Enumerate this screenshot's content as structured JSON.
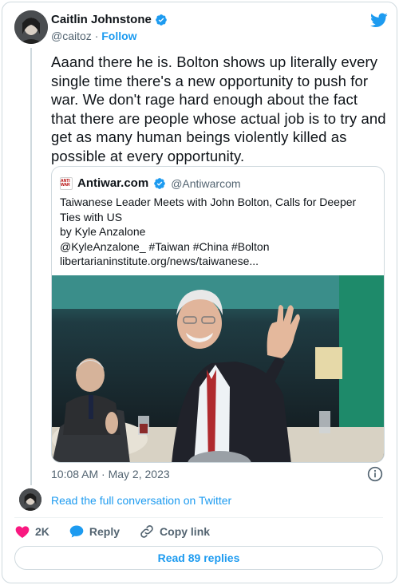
{
  "author": {
    "name": "Caitlin Johnstone",
    "handle": "@caitoz",
    "separator": "·",
    "follow_label": "Follow"
  },
  "tweet": {
    "text": "Aaand there he is. Bolton shows up literally every single time there's a new opportunity to push for war. We don't rage hard enough about the fact that there are people whose actual job is to try and get as many human beings violently killed as possible at every opportunity.",
    "timestamp": "10:08 AM · May 2, 2023"
  },
  "quote": {
    "logo_text": "ANTI WAR",
    "name": "Antiwar.com",
    "handle": "@Antiwarcom",
    "lines": [
      "Taiwanese Leader Meets with John Bolton, Calls for Deeper",
      "Ties with US",
      "by Kyle Anzalone",
      "@KyleAnzalone_ #Taiwan #China #Bolton",
      "libertarianinstitute.org/news/taiwanese..."
    ]
  },
  "conversation_link": "Read the full conversation on Twitter",
  "actions": {
    "like_count": "2K",
    "reply_label": "Reply",
    "copy_label": "Copy link"
  },
  "replies_button": "Read 89 replies",
  "colors": {
    "accent": "#1d9bf0",
    "like": "#f91880",
    "muted": "#536471"
  }
}
